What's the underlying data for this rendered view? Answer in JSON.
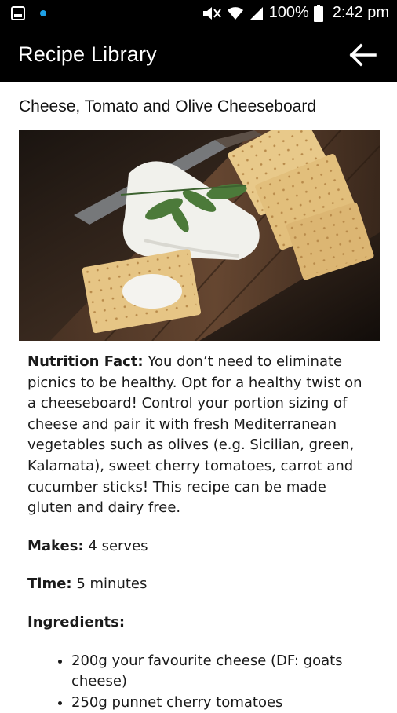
{
  "status_bar": {
    "battery": "100%",
    "time": "2:42 pm"
  },
  "app_bar": {
    "title": "Recipe Library"
  },
  "recipe": {
    "title": "Cheese, Tomato and Olive Cheeseboard",
    "image_alt": "cheese, crackers and herbs on a wooden board",
    "nutrition": {
      "label": "Nutrition Fact:",
      "text": " You don’t need to eliminate picnics to be healthy. Opt for a healthy twist on a cheeseboard! Control your portion sizing of cheese and pair it with fresh Mediterranean vegetables such as olives (e.g. Sicilian, green, Kalamata), sweet cherry tomatoes, carrot and cucumber sticks! This recipe can be made gluten and dairy free."
    },
    "makes": {
      "label": "Makes:",
      "value": " 4 serves"
    },
    "time": {
      "label": "Time:",
      "value": " 5 minutes"
    },
    "ingredients_label": "Ingredients:",
    "ingredients": [
      "200g your favourite cheese (DF: goats cheese)",
      "250g punnet cherry tomatoes"
    ]
  }
}
